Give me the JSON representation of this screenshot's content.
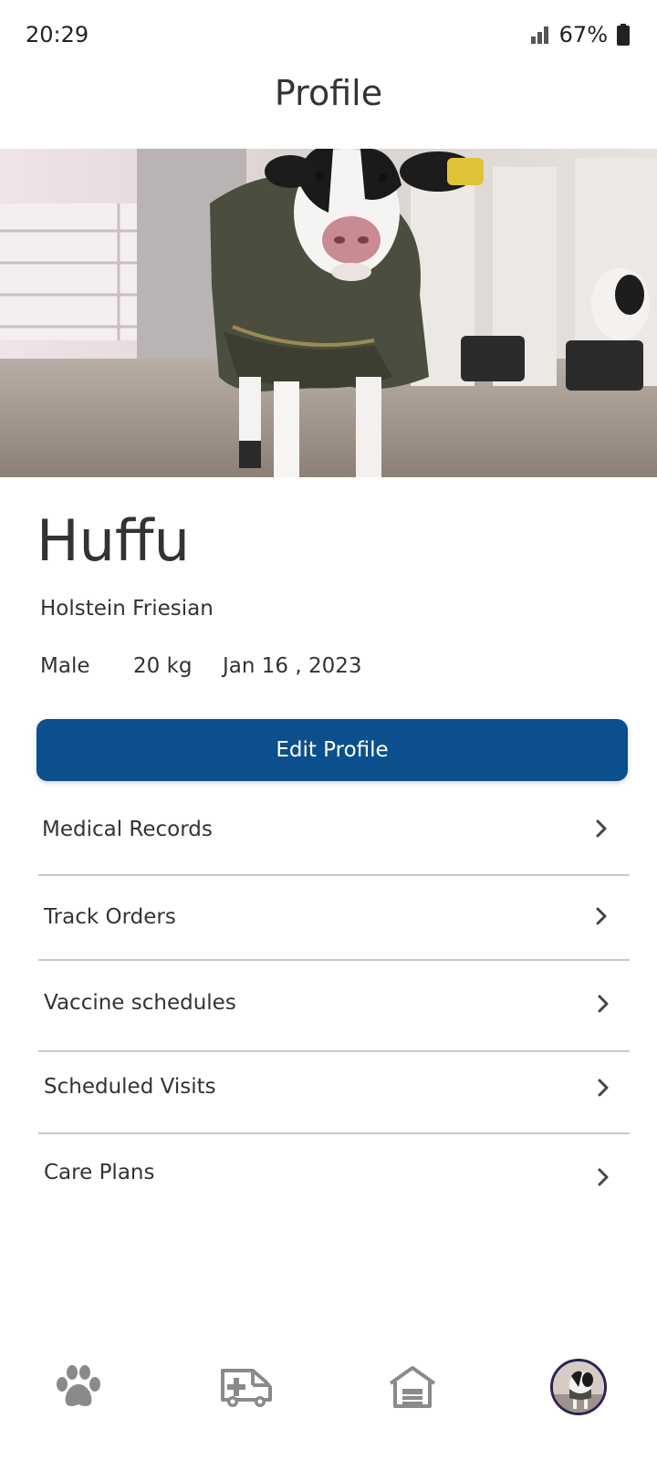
{
  "status_bar": {
    "time": "20:29",
    "battery": "67%"
  },
  "header": {
    "title": "Profile"
  },
  "profile": {
    "name": "Huffu",
    "breed": "Holstein Friesian",
    "gender": "Male",
    "weight": "20 kg",
    "date": "Jan 16 , 2023",
    "edit_label": "Edit Profile"
  },
  "menu": {
    "items": [
      {
        "label": "Medical Records"
      },
      {
        "label": "Track Orders"
      },
      {
        "label": "Vaccine schedules"
      },
      {
        "label": "Scheduled Visits"
      },
      {
        "label": "Care Plans"
      }
    ]
  },
  "bottom_nav": {
    "items": [
      {
        "icon": "paw-icon"
      },
      {
        "icon": "ambulance-icon"
      },
      {
        "icon": "home-icon"
      },
      {
        "icon": "avatar"
      }
    ]
  },
  "colors": {
    "primary": "#0b4f8c",
    "avatar_ring": "#2a2354",
    "nav_icon": "#8a8a8a"
  }
}
